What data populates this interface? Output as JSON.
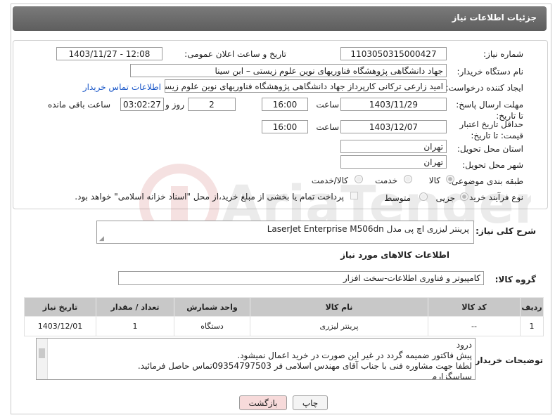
{
  "header": {
    "title": "جزئیات اطلاعات نیاز"
  },
  "form": {
    "need_number_label": "شماره نیاز:",
    "need_number": "1103050315000427",
    "announce_label": "تاریخ و ساعت اعلان عمومی:",
    "announce_value": "1403/11/27 - 12:08",
    "buyer_org_label": "نام دستگاه خریدار:",
    "buyer_org": "جهاد دانشگاهی پژوهشگاه فناوریهای نوین علوم زیستی – ابن سینا",
    "creator_label": "ایجاد کننده درخواست:",
    "creator": "امید  زارعی ترکانی  کارپرداز جهاد دانشگاهی پژوهشگاه فناوریهای نوین علوم زیستی",
    "buyer_contact_link": "اطلاعات تماس خریدار",
    "reply_deadline_label": "مهلت ارسال پاسخ: تا تاریخ:",
    "reply_date": "1403/11/29",
    "time_label": "ساعت",
    "reply_time": "16:00",
    "days_value": "2",
    "days_label": "روز و",
    "remaining_time": "03:02:27",
    "remaining_label": "ساعت باقی مانده",
    "validity_label": "حداقل تاریخ اعتبار قیمت: تا تاریخ:",
    "validity_date": "1403/12/07",
    "validity_time": "16:00",
    "province_label": "استان محل تحویل:",
    "province": "تهران",
    "city_label": "شهر محل تحویل:",
    "city": "تهران",
    "category_label": "طبقه بندی موضوعی:",
    "category_options": [
      "کالا",
      "خدمت",
      "کالا/خدمت"
    ],
    "process_label": "نوع فرآیند خرید :",
    "process_options": [
      "جزیی",
      "متوسط"
    ],
    "payment_note": "پرداخت تمام یا بخشی از مبلغ خرید،از محل \"اسناد خزانه اسلامی\" خواهد بود."
  },
  "description": {
    "label": "شرح کلی نیاز:",
    "value": "پرینتر لیزری اچ پی مدل LaserJet Enterprise M506dn"
  },
  "goods_info_title": "اطلاعات کالاهای مورد نیاز",
  "goods_group": {
    "label": "گروه کالا:",
    "value": "کامپیوتر و فناوری اطلاعات-سخت افزار"
  },
  "table": {
    "headers": [
      "ردیف",
      "کد کالا",
      "نام کالا",
      "واحد شمارش",
      "تعداد / مقدار",
      "تاریخ نیاز"
    ],
    "rows": [
      [
        "1",
        "--",
        "پرینتر لیزری",
        "دستگاه",
        "1",
        "1403/12/01"
      ]
    ]
  },
  "buyer_notes": {
    "label": "توضیحات خریدار:",
    "lines": [
      "درود",
      "پیش فاکتور ضمیمه گردد در غیر این صورت در خرید اعمال نمیشود.",
      "لطفا جهت مشاوره فنی با جناب آقای مهندس اسلامی فر 09354797503تماس حاصل فرمائید.",
      "سپاسگزارم"
    ]
  },
  "buttons": {
    "print": "چاپ",
    "back": "بازگشت"
  },
  "watermark_text": "AriaTender.net",
  "colors": {
    "header": "#6b6b6b",
    "link": "#1a57c8",
    "table_header": "#c8c8c8",
    "back_button": "#f7dada"
  }
}
